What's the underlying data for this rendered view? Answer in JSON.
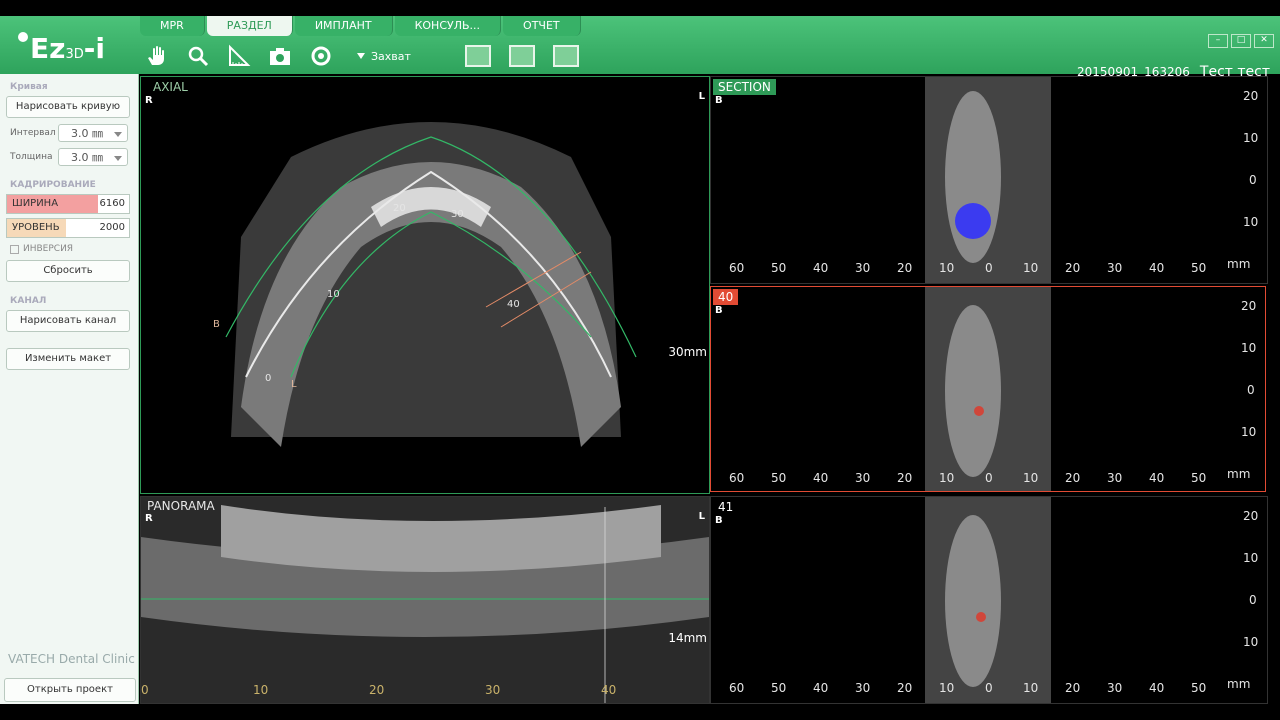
{
  "app": {
    "logo": "Ez",
    "logo_sub": "3D",
    "logo_i": "-i"
  },
  "tabs": [
    {
      "label": "MPR"
    },
    {
      "label": "РАЗДЕЛ"
    },
    {
      "label": "ИМПЛАНТ"
    },
    {
      "label": "КОНСУЛЬ..."
    },
    {
      "label": "ОТЧЕТ"
    }
  ],
  "toolbar": {
    "capture_label": "Захват"
  },
  "patient": {
    "id": "20150901_163206",
    "name": "Тест тест"
  },
  "sidebar": {
    "curve_title": "Кривая",
    "draw_curve": "Нарисовать кривую",
    "interval_label": "Интервал",
    "interval_value": "3.0 ㎜",
    "thickness_label": "Толщина",
    "thickness_value": "3.0 ㎜",
    "cropping_title": "КАДРИРОВАНИЕ",
    "width_label": "ШИРИНА",
    "width_value": "6160",
    "level_label": "УРОВЕНЬ",
    "level_value": "2000",
    "inversion_label": "ИНВЕРСИЯ",
    "reset": "Сбросить",
    "channel_title": "КАНАЛ",
    "draw_channel": "Нарисовать канал",
    "change_layout": "Изменить макет",
    "clinic": "VATECH Dental Clinic",
    "open_project": "Открыть проект"
  },
  "axial": {
    "title": "AXIAL",
    "left": "R",
    "right": "L",
    "scale": "30mm",
    "curve_labels": [
      "0",
      "10",
      "20",
      "30",
      "40"
    ],
    "b": "B",
    "l": "L",
    "mm": "mm"
  },
  "panorama": {
    "title": "PANORAMA",
    "left": "R",
    "right": "L",
    "scale": "14mm",
    "ticks": [
      "0",
      "10",
      "20",
      "30",
      "40"
    ]
  },
  "sections": [
    {
      "title": "SECTION",
      "b": "B",
      "xticks": [
        "60",
        "50",
        "40",
        "30",
        "20",
        "10",
        "0",
        "10",
        "20",
        "30",
        "40",
        "50"
      ],
      "yticks": [
        "20",
        "10",
        "0",
        "10"
      ],
      "unit": "mm"
    },
    {
      "title": "40",
      "b": "B",
      "xticks": [
        "60",
        "50",
        "40",
        "30",
        "20",
        "10",
        "0",
        "10",
        "20",
        "30",
        "40",
        "50"
      ],
      "yticks": [
        "20",
        "10",
        "0",
        "10"
      ],
      "unit": "mm"
    },
    {
      "title": "41",
      "b": "B",
      "xticks": [
        "60",
        "50",
        "40",
        "30",
        "20",
        "10",
        "0",
        "10",
        "20",
        "30",
        "40",
        "50"
      ],
      "yticks": [
        "20",
        "10",
        "0",
        "10"
      ],
      "unit": "mm"
    }
  ]
}
